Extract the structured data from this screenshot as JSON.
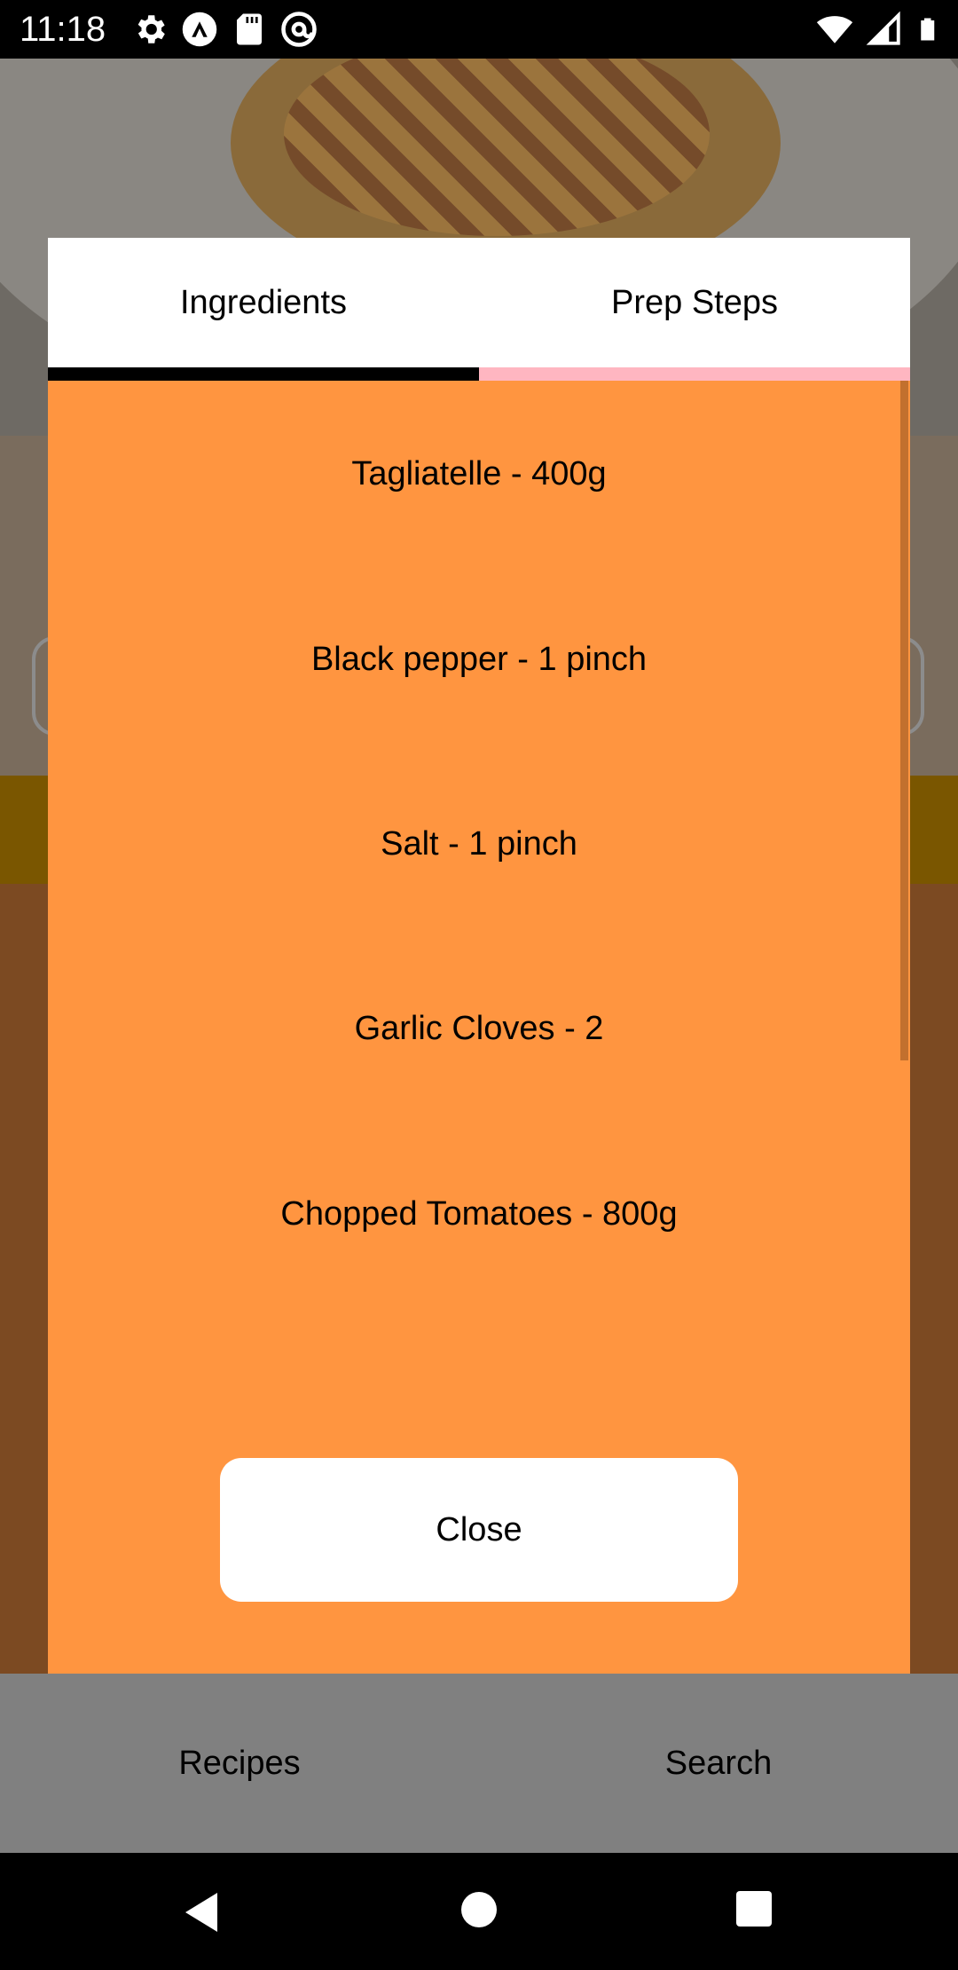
{
  "status_bar": {
    "time": "11:18",
    "left_icons": [
      "gear-icon",
      "a-logo-icon",
      "sd-card-icon",
      "at-sign-icon"
    ],
    "right_icons": [
      "wifi-icon",
      "signal-icon",
      "battery-icon"
    ]
  },
  "modal": {
    "tabs": [
      {
        "label": "Ingredients",
        "selected": true
      },
      {
        "label": "Prep Steps",
        "selected": false
      }
    ],
    "ingredients": [
      "Tagliatelle - 400g",
      "Black pepper - 1 pinch",
      "Salt - 1 pinch",
      "Garlic Cloves - 2",
      "Chopped Tomatoes - 800g"
    ],
    "close_label": "Close"
  },
  "bottom_nav": {
    "items": [
      {
        "label": "Recipes"
      },
      {
        "label": "Search"
      }
    ]
  },
  "system_nav": [
    "back-icon",
    "home-icon",
    "recents-icon"
  ],
  "colors": {
    "modal_background": "#ff9540",
    "tab_active_indicator": "#000000",
    "tab_inactive_indicator": "#ffb6c1",
    "bottom_nav_background": "#808080"
  }
}
